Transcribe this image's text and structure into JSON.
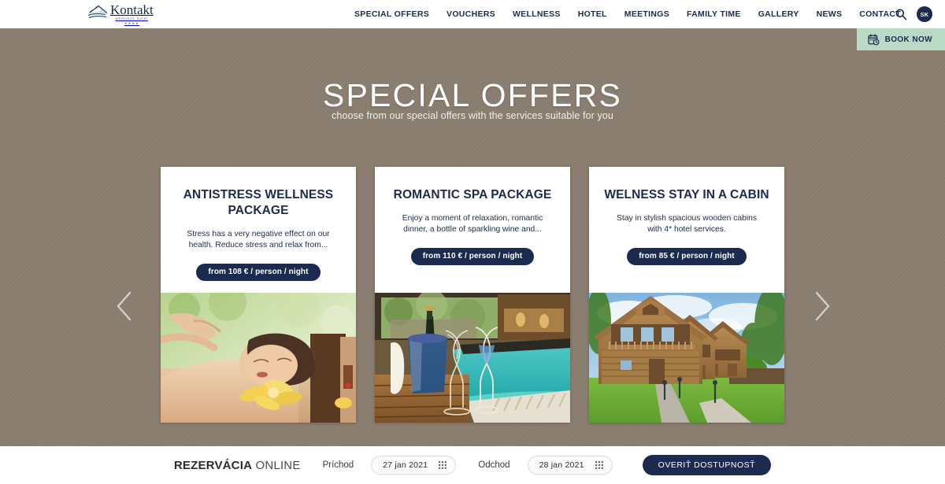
{
  "header": {
    "logo": {
      "name": "Kontakt",
      "subtitle": "wellness hotel",
      "stars": "★★★★",
      "icon": "wave-logo-icon"
    },
    "nav": [
      {
        "label": "SPECIAL OFFERS",
        "name": "nav-special-offers"
      },
      {
        "label": "VOUCHERS",
        "name": "nav-vouchers"
      },
      {
        "label": "WELLNESS",
        "name": "nav-wellness"
      },
      {
        "label": "HOTEL",
        "name": "nav-hotel"
      },
      {
        "label": "MEETINGS",
        "name": "nav-meetings"
      },
      {
        "label": "FAMILY TIME",
        "name": "nav-family-time"
      },
      {
        "label": "GALLERY",
        "name": "nav-gallery"
      },
      {
        "label": "NEWS",
        "name": "nav-news"
      },
      {
        "label": "CONTACT",
        "name": "nav-contact"
      }
    ],
    "search_icon": "search-icon",
    "language_badge": "SK"
  },
  "book_now": {
    "label": "BOOK NOW",
    "icon": "calendar-clock-icon",
    "background": "#b9dbc6"
  },
  "hero": {
    "title": "SPECIAL OFFERS",
    "subtitle": "choose from our special offers with the services suitable for you",
    "background": "#8a7e70"
  },
  "carousel": {
    "prev_icon": "chevron-left-icon",
    "next_icon": "chevron-right-icon",
    "cards": [
      {
        "title": "ANTISTRESS WELLNESS PACKAGE",
        "description": "Stress has a very negative effect on our health. Reduce stress and relax from...",
        "price": "from 108 € / person / night",
        "image_alt": "spa-massage-photo"
      },
      {
        "title": "ROMANTIC SPA PACKAGE",
        "description": "Enjoy a moment of relaxation, romantic dinner, a bottle of sparkling wine and...",
        "price": "from 110 € / person / night",
        "image_alt": "champagne-poolside-photo"
      },
      {
        "title": "WELNESS STAY IN A CABIN",
        "description": "Stay in stylish spacious wooden cabins with 4* hotel services.",
        "price": "from 85 € / person / night",
        "image_alt": "wooden-cabins-photo"
      }
    ]
  },
  "booking": {
    "title_bold": "REZERVÁCIA",
    "title_light": "ONLINE",
    "arrival_label": "Príchod",
    "arrival_date": "27 jan 2021",
    "departure_label": "Odchod",
    "departure_date": "28 jan 2021",
    "submit_label": "OVERIŤ DOSTUPNOSŤ",
    "calendar_icon": "calendar-grid-icon"
  },
  "colors": {
    "navy": "#1b2a4e",
    "taupe": "#8a7e70",
    "mint": "#b9dbc6"
  }
}
